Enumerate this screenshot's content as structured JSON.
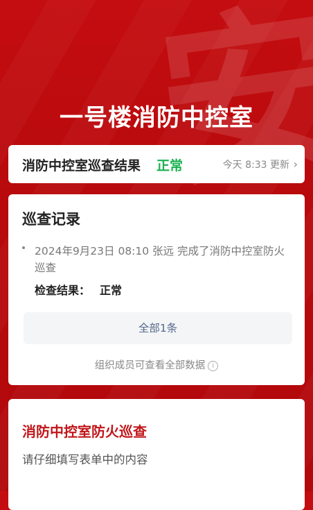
{
  "watermark": "安",
  "page_title": "一号楼消防中控室",
  "status": {
    "label": "消防中控室巡查结果",
    "value": "正常",
    "updated": "今天 8:33 更新"
  },
  "records": {
    "heading": "巡查记录",
    "entry_text": "2024年9月23日 08:10  张远  完成了消防中控室防火巡查",
    "result_label": "检查结果：",
    "result_value": "正常",
    "all_button": "全部1条",
    "note": "组织成员可查看全部数据"
  },
  "form": {
    "title": "消防中控室防火巡查",
    "subtitle": "请仔细填写表单中的内容"
  },
  "colors": {
    "brand_red": "#c40d10",
    "ok_green": "#18b14f",
    "link_blue": "#55698c"
  }
}
